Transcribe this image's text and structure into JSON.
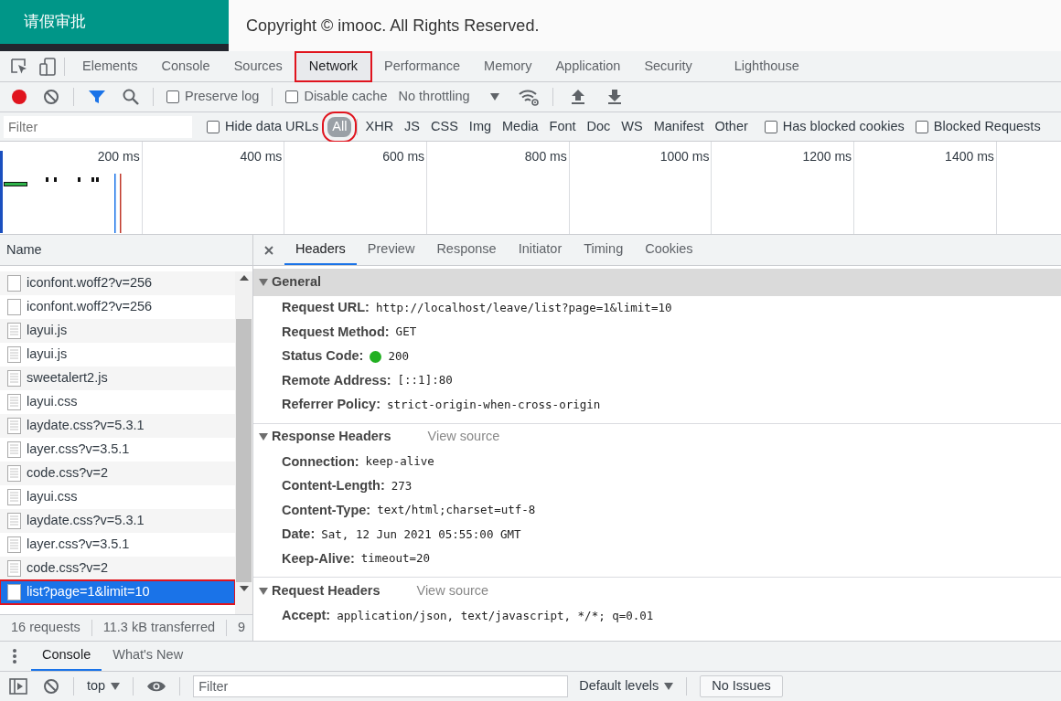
{
  "page_header": {
    "title": "请假审批",
    "footer": "Copyright © imooc. All Rights Reserved."
  },
  "devtools_tabs": [
    {
      "label": "Elements",
      "selected": false,
      "highlighted": false
    },
    {
      "label": "Console",
      "selected": false,
      "highlighted": false
    },
    {
      "label": "Sources",
      "selected": false,
      "highlighted": false
    },
    {
      "label": "Network",
      "selected": true,
      "highlighted": true
    },
    {
      "label": "Performance",
      "selected": false,
      "highlighted": false
    },
    {
      "label": "Memory",
      "selected": false,
      "highlighted": false
    },
    {
      "label": "Application",
      "selected": false,
      "highlighted": false
    },
    {
      "label": "Security",
      "selected": false,
      "highlighted": false
    },
    {
      "label": "Lighthouse",
      "selected": false,
      "highlighted": false
    }
  ],
  "toolbar": {
    "recording": true,
    "filter_on": true,
    "preserve_log": {
      "label": "Preserve log",
      "checked": false
    },
    "disable_cache": {
      "label": "Disable cache",
      "checked": false
    },
    "throttling": "No throttling"
  },
  "filter_bar": {
    "placeholder": "Filter",
    "hide_data_urls": {
      "label": "Hide data URLs",
      "checked": false
    },
    "types": [
      {
        "label": "All",
        "selected": true,
        "highlighted": true
      },
      {
        "label": "XHR",
        "selected": false,
        "highlighted": false
      },
      {
        "label": "JS",
        "selected": false,
        "highlighted": false
      },
      {
        "label": "CSS",
        "selected": false,
        "highlighted": false
      },
      {
        "label": "Img",
        "selected": false,
        "highlighted": false
      },
      {
        "label": "Media",
        "selected": false,
        "highlighted": false
      },
      {
        "label": "Font",
        "selected": false,
        "highlighted": false
      },
      {
        "label": "Doc",
        "selected": false,
        "highlighted": false
      },
      {
        "label": "WS",
        "selected": false,
        "highlighted": false
      },
      {
        "label": "Manifest",
        "selected": false,
        "highlighted": false
      },
      {
        "label": "Other",
        "selected": false,
        "highlighted": false
      }
    ],
    "has_blocked_cookies": {
      "label": "Has blocked cookies",
      "checked": false
    },
    "blocked_requests": {
      "label": "Blocked Requests",
      "checked": false
    }
  },
  "timeline": {
    "ticks": [
      "200 ms",
      "400 ms",
      "600 ms",
      "800 ms",
      "1000 ms",
      "1200 ms",
      "1400 ms"
    ]
  },
  "requests": {
    "header": "Name",
    "rows": [
      {
        "name": "iconfont.woff2?v=256",
        "kind": "blank",
        "selected": false,
        "highlighted": false
      },
      {
        "name": "iconfont.woff2?v=256",
        "kind": "blank",
        "selected": false,
        "highlighted": false
      },
      {
        "name": "layui.js",
        "kind": "text",
        "selected": false,
        "highlighted": false
      },
      {
        "name": "layui.js",
        "kind": "text",
        "selected": false,
        "highlighted": false
      },
      {
        "name": "sweetalert2.js",
        "kind": "text",
        "selected": false,
        "highlighted": false
      },
      {
        "name": "layui.css",
        "kind": "text",
        "selected": false,
        "highlighted": false
      },
      {
        "name": "laydate.css?v=5.3.1",
        "kind": "text",
        "selected": false,
        "highlighted": false
      },
      {
        "name": "layer.css?v=3.5.1",
        "kind": "text",
        "selected": false,
        "highlighted": false
      },
      {
        "name": "code.css?v=2",
        "kind": "text",
        "selected": false,
        "highlighted": false
      },
      {
        "name": "layui.css",
        "kind": "text",
        "selected": false,
        "highlighted": false
      },
      {
        "name": "laydate.css?v=5.3.1",
        "kind": "text",
        "selected": false,
        "highlighted": false
      },
      {
        "name": "layer.css?v=3.5.1",
        "kind": "text",
        "selected": false,
        "highlighted": false
      },
      {
        "name": "code.css?v=2",
        "kind": "text",
        "selected": false,
        "highlighted": false
      },
      {
        "name": "list?page=1&limit=10",
        "kind": "blank",
        "selected": true,
        "highlighted": true
      }
    ],
    "summary": [
      "16 requests",
      "11.3 kB transferred",
      "9"
    ]
  },
  "details": {
    "tabs": [
      {
        "label": "Headers",
        "selected": true
      },
      {
        "label": "Preview",
        "selected": false
      },
      {
        "label": "Response",
        "selected": false
      },
      {
        "label": "Initiator",
        "selected": false
      },
      {
        "label": "Timing",
        "selected": false
      },
      {
        "label": "Cookies",
        "selected": false
      }
    ],
    "sections": [
      {
        "title": "General",
        "expanded": true,
        "fields": [
          {
            "name": "Request URL:",
            "value": "http://localhost/leave/list?page=1&limit=10"
          },
          {
            "name": "Request Method:",
            "value": "GET"
          },
          {
            "name": "Status Code:",
            "value": "200",
            "color": "#22b022"
          },
          {
            "name": "Remote Address:",
            "value": "[::1]:80"
          },
          {
            "name": "Referrer Policy:",
            "value": "strict-origin-when-cross-origin"
          }
        ]
      },
      {
        "title": "Response Headers",
        "expanded": true,
        "view_source": "View source",
        "fields": [
          {
            "name": "Connection:",
            "value": "keep-alive"
          },
          {
            "name": "Content-Length:",
            "value": "273"
          },
          {
            "name": "Content-Type:",
            "value": "text/html;charset=utf-8"
          },
          {
            "name": "Date:",
            "value": "Sat, 12 Jun 2021 05:55:00 GMT"
          },
          {
            "name": "Keep-Alive:",
            "value": "timeout=20"
          }
        ]
      },
      {
        "title": "Request Headers",
        "expanded": true,
        "view_source": "View source",
        "fields": [
          {
            "name": "Accept:",
            "value": "application/json, text/javascript, */*; q=0.01"
          }
        ]
      }
    ]
  },
  "drawer": {
    "tabs": [
      {
        "label": "Console",
        "selected": true
      },
      {
        "label": "What's New",
        "selected": false
      }
    ],
    "context": "top",
    "filter_placeholder": "Filter",
    "levels": "Default levels",
    "issues": "No Issues"
  }
}
